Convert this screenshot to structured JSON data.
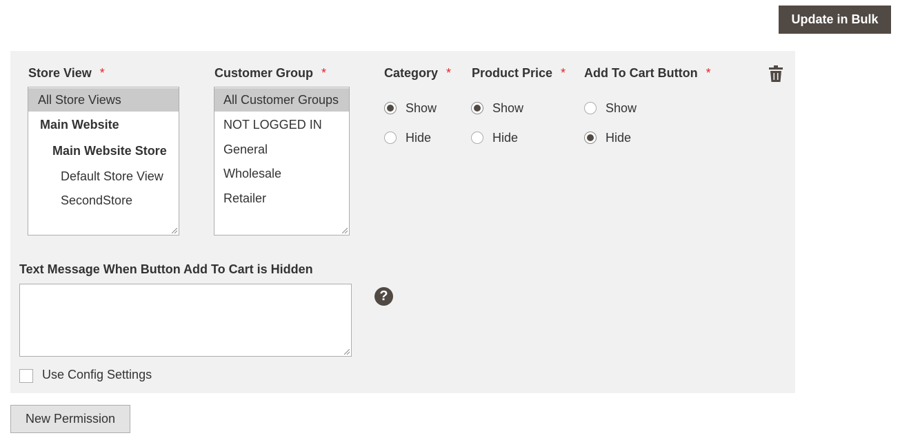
{
  "toolbar": {
    "update_bulk_label": "Update in Bulk"
  },
  "form": {
    "store_view": {
      "label": "Store View",
      "required_mark": "*",
      "options": [
        {
          "label": "All Store Views",
          "selected": true,
          "bold": false
        },
        {
          "label": "Main Website",
          "selected": false,
          "bold": true
        },
        {
          "label": "Main Website Store",
          "selected": false,
          "bold": true
        },
        {
          "label": "Default Store View",
          "selected": false,
          "bold": false
        },
        {
          "label": "SecondStore",
          "selected": false,
          "bold": false
        }
      ]
    },
    "customer_group": {
      "label": "Customer Group",
      "required_mark": "*",
      "options": [
        {
          "label": "All Customer Groups",
          "selected": true
        },
        {
          "label": "NOT LOGGED IN",
          "selected": false
        },
        {
          "label": "General",
          "selected": false
        },
        {
          "label": "Wholesale",
          "selected": false
        },
        {
          "label": "Retailer",
          "selected": false
        }
      ]
    },
    "category": {
      "label": "Category",
      "required_mark": "*",
      "options": [
        {
          "label": "Show",
          "checked": true
        },
        {
          "label": "Hide",
          "checked": false
        }
      ]
    },
    "product_price": {
      "label": "Product Price",
      "required_mark": "*",
      "options": [
        {
          "label": "Show",
          "checked": true
        },
        {
          "label": "Hide",
          "checked": false
        }
      ]
    },
    "add_to_cart": {
      "label": "Add To Cart Button",
      "required_mark": "*",
      "options": [
        {
          "label": "Show",
          "checked": false
        },
        {
          "label": "Hide",
          "checked": true
        }
      ]
    },
    "text_message": {
      "label": "Text Message When Button Add To Cart is Hidden",
      "value": ""
    },
    "help_icon": {
      "glyph": "?",
      "icon": "question-circle-icon"
    },
    "use_config": {
      "label": "Use Config Settings",
      "checked": false
    },
    "delete_icon": "trash-icon"
  },
  "footer": {
    "new_permission_label": "New Permission"
  },
  "colors": {
    "button_dark": "#514943",
    "panel_bg": "#f1f1f1",
    "required": "#e22626",
    "selected_option": "#cacaca"
  }
}
